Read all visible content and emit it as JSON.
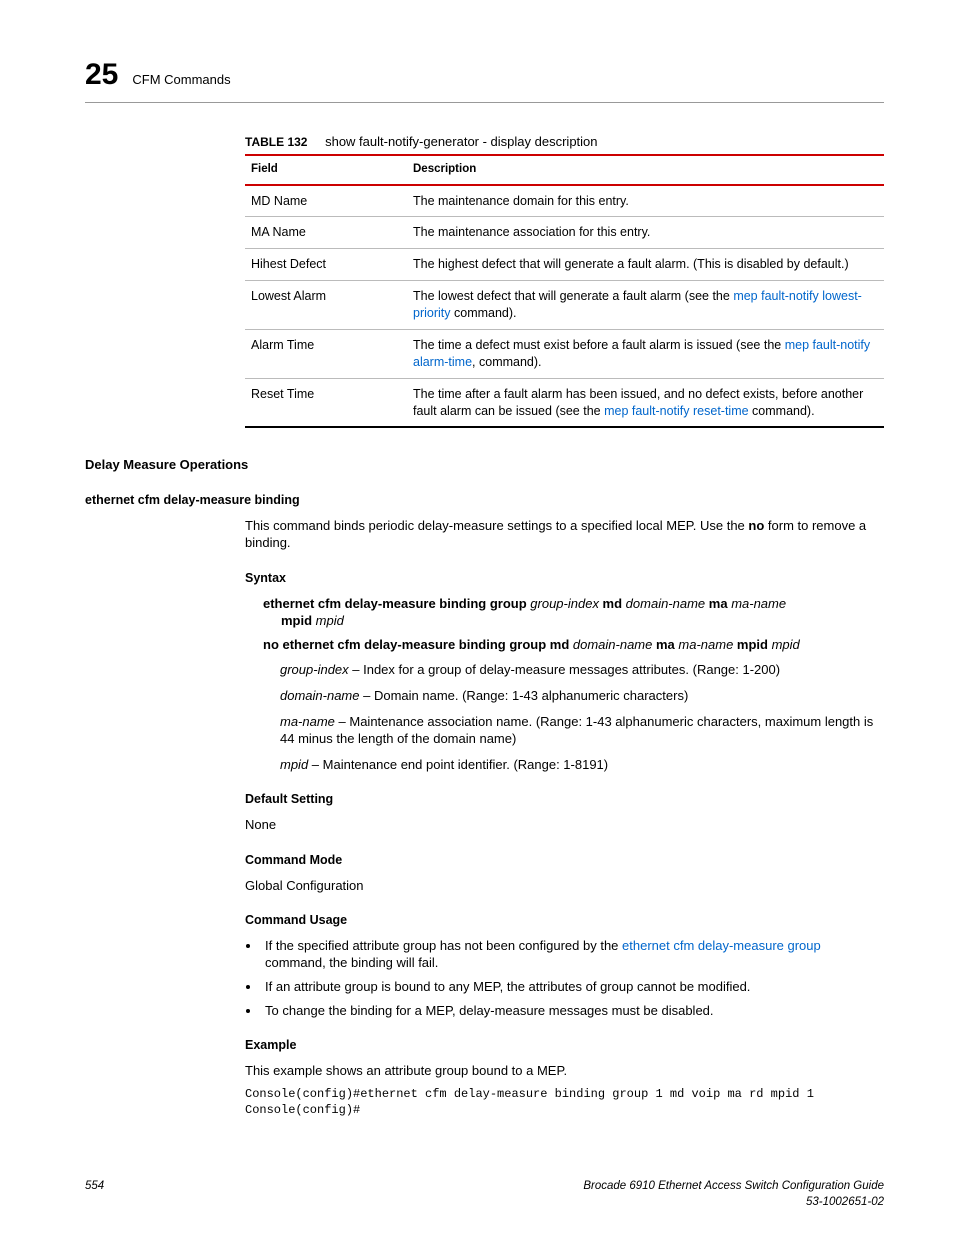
{
  "chapter": {
    "num": "25",
    "title": "CFM Commands"
  },
  "table": {
    "label": "TABLE 132",
    "caption": "show fault-notify-generator - display description",
    "head": {
      "c1": "Field",
      "c2": "Description"
    },
    "rows": [
      {
        "f": "MD Name",
        "d": "The maintenance domain for this entry."
      },
      {
        "f": "MA Name",
        "d": "The maintenance association for this entry."
      },
      {
        "f": "Hihest Defect",
        "d": "The highest defect that will generate a fault alarm. (This is disabled by default.)"
      },
      {
        "f": "Lowest Alarm",
        "d1": "The lowest defect that will generate a fault alarm (see the ",
        "link": "mep fault-notify lowest-priority",
        "d2": " command)."
      },
      {
        "f": "Alarm Time",
        "d1": "The time a defect must exist before a fault alarm is issued (see the ",
        "link": "mep fault-notify alarm-time",
        "d2": ", command)."
      },
      {
        "f": "Reset Time",
        "d1": "The time after a fault alarm has been issued, and no defect exists, before another fault alarm can be issued (see the ",
        "link": "mep fault-notify reset-time",
        "d2": " command)."
      }
    ]
  },
  "section": {
    "h_delay": "Delay Measure Operations",
    "h_cmd": "ethernet cfm delay-measure binding",
    "intro_a": "This command binds periodic delay-measure settings to a specified local MEP. Use the ",
    "intro_no": "no",
    "intro_b": " form to remove a binding.",
    "h_syntax": "Syntax",
    "syn1": {
      "a": "ethernet cfm delay-measure binding group ",
      "gi": "group-index",
      "b": " md ",
      "dn": "domain-name",
      "c": " ma ",
      "mn": "ma-name",
      "d": "mpid ",
      "mp": "mpid"
    },
    "syn2": {
      "a": "no ethernet cfm delay-measure binding group md ",
      "dn": "domain-name",
      "b": " ma ",
      "mn": "ma-name",
      "c": " mpid ",
      "mp": "mpid"
    },
    "defs": {
      "gi_t": "group-index",
      "gi_d": " – Index for a group of delay-measure messages attributes. (Range: 1-200)",
      "dn_t": "domain-name",
      "dn_d": " – Domain name. (Range: 1-43 alphanumeric characters)",
      "mn_t": "ma-name",
      "mn_d": " – Maintenance association name. (Range: 1-43 alphanumeric characters, maximum length is 44 minus the length of the domain name)",
      "mp_t": "mpid",
      "mp_d": " – Maintenance end point identifier. (Range: 1-8191)"
    },
    "h_default": "Default Setting",
    "default_val": "None",
    "h_mode": "Command Mode",
    "mode_val": "Global Configuration",
    "h_usage": "Command Usage",
    "usage": {
      "u1a": "If the specified attribute group has not been configured by the ",
      "u1link": "ethernet cfm delay-measure group",
      "u1b": " command, the binding will fail.",
      "u2": "If an attribute group is bound to any MEP, the attributes of group cannot be modified.",
      "u3": "To change the binding for a MEP, delay-measure messages must be disabled."
    },
    "h_example": "Example",
    "example_intro": "This example shows an attribute group bound to a MEP.",
    "code": "Console(config)#ethernet cfm delay-measure binding group 1 md voip ma rd mpid 1\nConsole(config)#"
  },
  "footer": {
    "page": "554",
    "book": "Brocade 6910 Ethernet Access Switch Configuration Guide",
    "docnum": "53-1002651-02"
  }
}
